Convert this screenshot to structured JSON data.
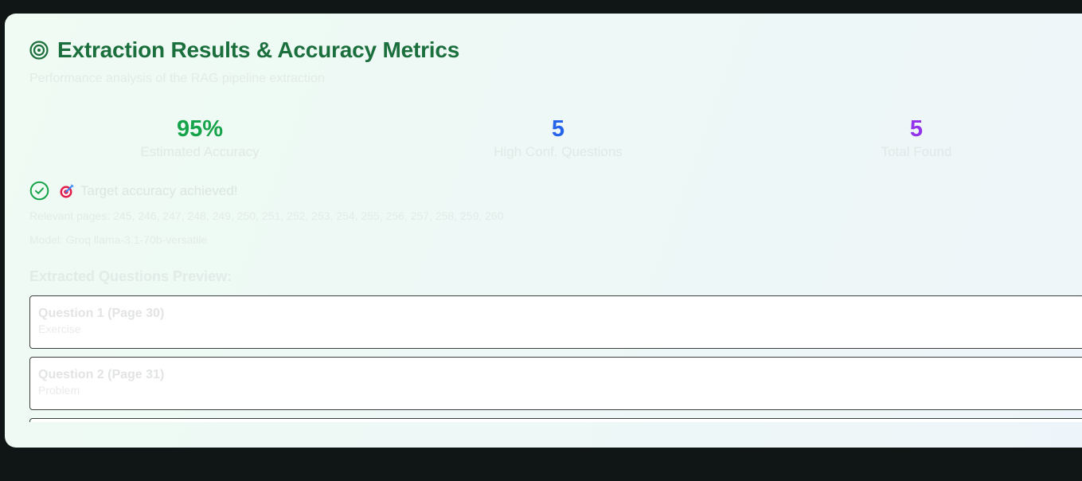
{
  "header": {
    "title": "Extraction Results & Accuracy Metrics",
    "subtitle": "Performance analysis of the RAG pipeline extraction"
  },
  "metrics": [
    {
      "value": "95%",
      "label": "Estimated Accuracy",
      "color": "#16a34a"
    },
    {
      "value": "5",
      "label": "High Conf. Questions",
      "color": "#2563eb"
    },
    {
      "value": "5",
      "label": "Total Found",
      "color": "#9333ea"
    }
  ],
  "status": {
    "text": "Target accuracy achieved!",
    "icon": "check-circle-icon",
    "emoji_icon": "direct-hit-icon"
  },
  "info": {
    "pages": "Relevant pages: 245, 246, 247, 248, 249, 250, 251, 252, 253, 254, 255, 256, 257, 258, 259, 260",
    "model": "Model: Groq llama-3.1-70b-versatile"
  },
  "preview": {
    "heading": "Extracted Questions Preview:",
    "questions": [
      {
        "title": "Question 1 (Page 30)",
        "type": "Exercise"
      },
      {
        "title": "Question 2 (Page 31)",
        "type": "Problem"
      },
      {
        "title": "",
        "type": ""
      }
    ]
  },
  "colors": {
    "accent_green": "#1b6f3c",
    "background": "#0f1615"
  }
}
